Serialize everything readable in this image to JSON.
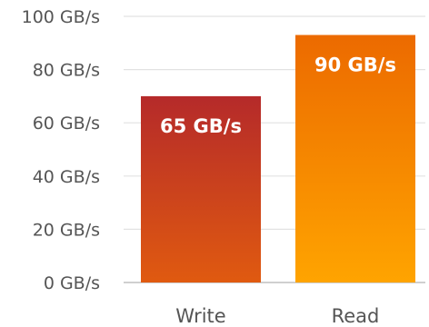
{
  "chart_data": {
    "type": "bar",
    "categories": [
      "Write",
      "Read"
    ],
    "values": [
      70,
      93
    ],
    "data_labels": [
      "65 GB/s",
      "90 GB/s"
    ],
    "y_ticks": [
      0,
      20,
      40,
      60,
      80,
      100
    ],
    "y_tick_labels": [
      "0 GB/s",
      "20 GB/s",
      "40 GB/s",
      "60 GB/s",
      "80 GB/s",
      "100 GB/s"
    ],
    "ylim": [
      0,
      100
    ],
    "grid": true,
    "title": "",
    "xlabel": "",
    "ylabel": "",
    "bar_gradients": [
      {
        "top": "#b52a2a",
        "bottom": "#e05a10"
      },
      {
        "top": "#ec6a00",
        "bottom": "#ffa400"
      }
    ],
    "grid_color": "#e2e2e2",
    "axis_color": "#bfbfbf",
    "text_color": "#555555",
    "data_label_color": "#ffffff"
  }
}
